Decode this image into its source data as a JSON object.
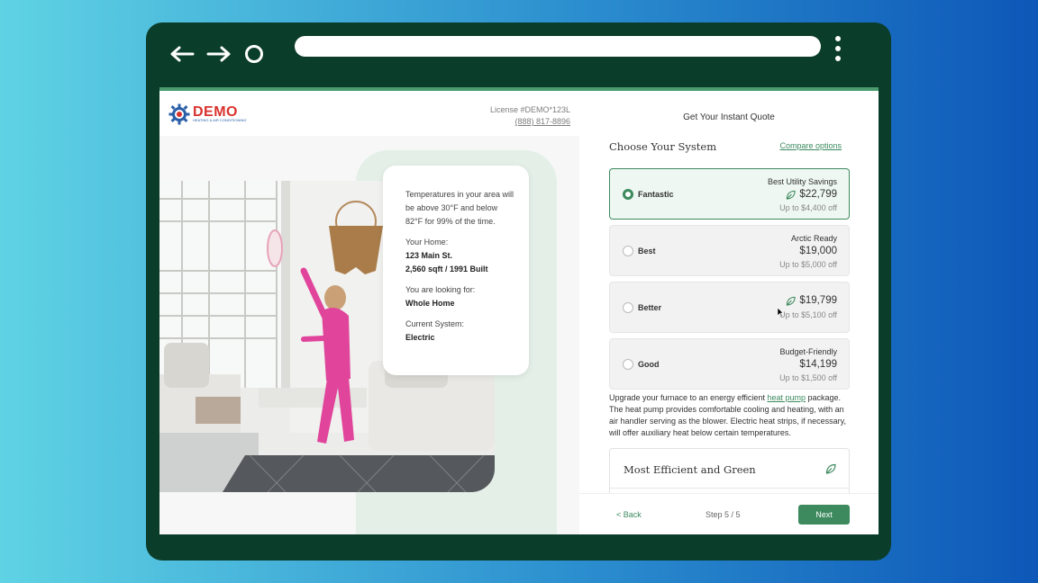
{
  "browser": {
    "back_icon": "arrow-left-icon",
    "forward_icon": "arrow-right-icon",
    "reload_icon": "circle-icon",
    "url": "",
    "menu_icon": "kebab-menu-icon"
  },
  "colors": {
    "frame": "#0b3d2b",
    "accent_green": "#3d8a5f",
    "brand_red": "#d9322e",
    "brand_blue": "#2a5fa8"
  },
  "header": {
    "logo_word": "DEMO",
    "logo_subtext": "HEATING & AIR CONDITIONING",
    "license": "License #DEMO*123L",
    "phone": "(888) 817-8896",
    "quote_title": "Get Your Instant Quote"
  },
  "info": {
    "temperature": "Temperatures in your area will be above 30°F and below 82°F for 99% of the time.",
    "home_label": "Your Home:",
    "home_address": "123 Main St.",
    "home_details": "2,560 sqft / 1991 Built",
    "looking_label": "You are looking for:",
    "looking_value": "Whole Home",
    "system_label": "Current System:",
    "system_value": "Electric"
  },
  "system": {
    "heading": "Choose Your System",
    "compare_link": "Compare options",
    "options": [
      {
        "name": "Fantastic",
        "tag": "Best Utility Savings",
        "price": "$22,799",
        "off": "Up to $4,400 off",
        "leaf": true,
        "selected": true
      },
      {
        "name": "Best",
        "tag": "Arctic Ready",
        "price": "$19,000",
        "off": "Up to $5,000 off",
        "leaf": false,
        "selected": false
      },
      {
        "name": "Better",
        "tag": "",
        "price": "$19,799",
        "off": "Up to $5,100 off",
        "leaf": true,
        "selected": false
      },
      {
        "name": "Good",
        "tag": "Budget-Friendly",
        "price": "$14,199",
        "off": "Up to $1,500 off",
        "leaf": false,
        "selected": false
      }
    ],
    "desc_before": "Upgrade your furnace to an energy efficient ",
    "desc_link": "heat pump",
    "desc_after": " package. The heat pump provides comfortable cooling and heating, with an air handler serving as the blower. Electric heat strips, if necessary, will offer auxiliary heat below certain temperatures.",
    "efficient_title": "Most Efficient and Green"
  },
  "footer": {
    "back": "< Back",
    "step": "Step 5 / 5",
    "next": "Next"
  }
}
